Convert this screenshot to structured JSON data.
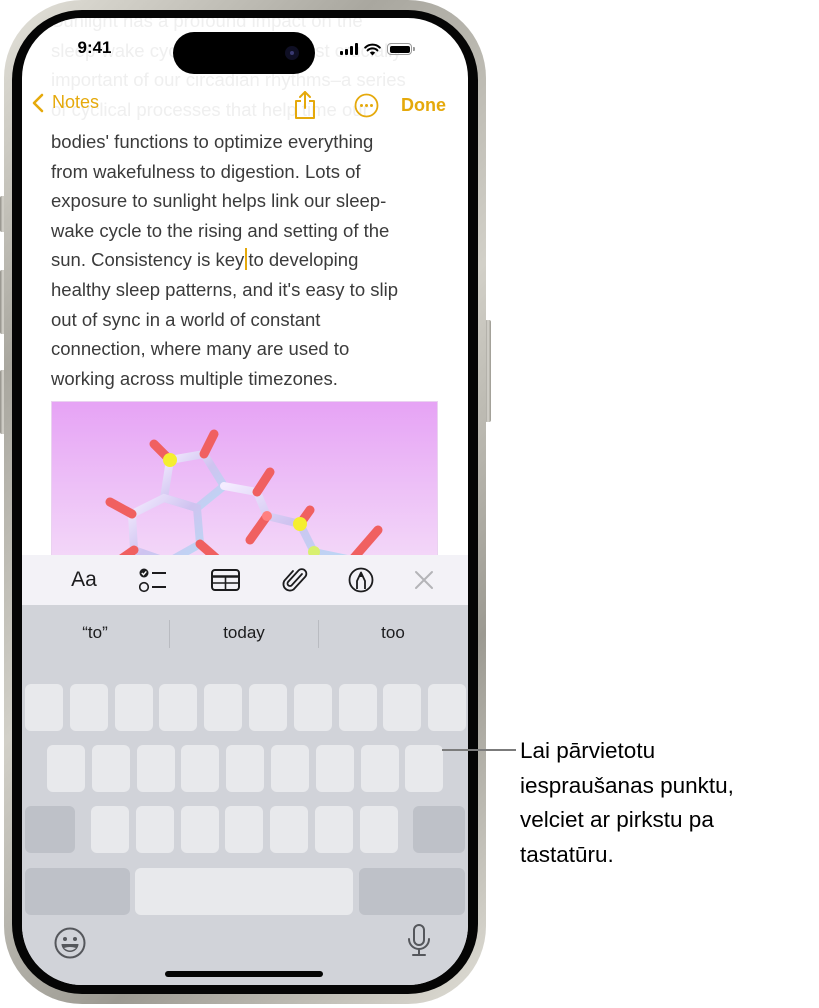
{
  "status_bar": {
    "time": "9:41"
  },
  "faded_text_lines": [
    "Sunlight has a profound impact on the",
    "sleep-wake cycle, one of the most crucially",
    "important of our circadian rhythms–a series",
    "of cyclical processes that help time our"
  ],
  "nav": {
    "back_label": "Notes",
    "share_icon": "share-icon",
    "more_icon": "ellipsis-circle-icon",
    "done_label": "Done"
  },
  "note": {
    "lines": [
      "bodies' functions to optimize everything",
      "from wakefulness to digestion. Lots of",
      "exposure to sunlight helps link our sleep-",
      "wake cycle to the rising and setting of the"
    ],
    "caret_line_before": "sun. Consistency is key",
    "caret_line_after": "to developing",
    "lines_after": [
      "healthy sleep patterns, and it's easy to slip",
      "out of sync in a world of constant",
      "connection, where many are used to",
      "working across multiple timezones."
    ],
    "image_description": "molecule-illustration"
  },
  "format_toolbar": {
    "items": [
      {
        "label": "Aa",
        "icon": "text-format-icon"
      },
      {
        "icon": "checklist-icon"
      },
      {
        "icon": "table-icon"
      },
      {
        "icon": "paperclip-icon"
      },
      {
        "icon": "markup-pen-icon"
      },
      {
        "icon": "close-icon"
      }
    ]
  },
  "keyboard": {
    "suggestions": [
      "“to”",
      "today",
      "too"
    ],
    "rows": [
      10,
      9,
      9,
      3
    ],
    "emoji_icon": "emoji-icon",
    "mic_icon": "microphone-icon"
  },
  "colors": {
    "accent": "#e5a90b",
    "keyboard_bg": "#d1d3d9",
    "key_light": "#e8e9ec",
    "key_dark": "#bec1c8",
    "toolbar_bg": "#f3f2f7"
  },
  "callout": {
    "lines": [
      "Lai pārvietotu",
      "iespraušanas punktu,",
      "velciet ar pirkstu pa",
      "tastatūru."
    ]
  }
}
